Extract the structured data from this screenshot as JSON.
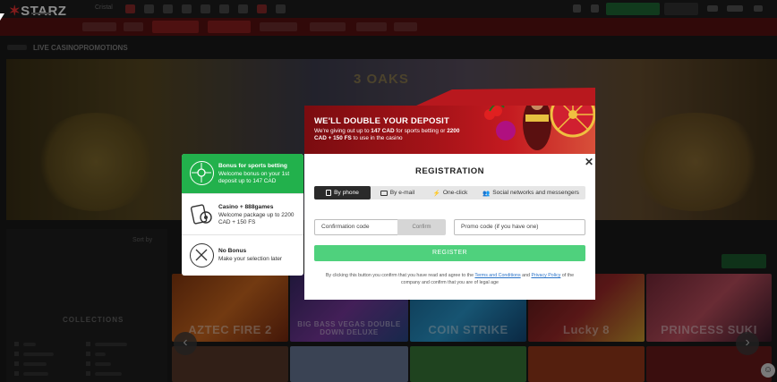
{
  "background": {
    "logo": "STARZ",
    "favorites_label": "Cristal",
    "subnav": [
      "LIVE CASINO",
      "PROMOTIONS"
    ],
    "filter_label": "Sort by",
    "collections_heading": "COLLECTIONS",
    "hero_logo": "3 OAKS",
    "games_row1": [
      "AZTEC FIRE 2",
      "BIG BASS VEGAS DOUBLE DOWN DELUXE",
      "COIN STRIKE",
      "",
      "Lucky 8",
      "PRINCESS SUKI"
    ],
    "prev_arrow": "‹",
    "next_arrow": "›",
    "chat_icon": "☺"
  },
  "bonus_panel": {
    "options": [
      {
        "title": "Bonus for sports betting",
        "desc": "Welcome bonus on your 1st deposit up to 147 CAD",
        "icon": "soccer-ball-icon",
        "active": true
      },
      {
        "title": "Casino + 888games",
        "desc": "Welcome package up to 2200 CAD + 150 FS",
        "icon": "casino-cards-icon",
        "active": false
      },
      {
        "title": "No Bonus",
        "desc": "Make your selection later",
        "icon": "no-bonus-icon",
        "active": false
      }
    ]
  },
  "promo": {
    "title": "WE'LL DOUBLE YOUR DEPOSIT",
    "text_prefix": "We're giving out up to ",
    "sports_amount": "147 CAD",
    "text_mid": " for sports betting or ",
    "casino_amount": "2200 CAD + 150 FS",
    "text_suffix": " to use in the casino"
  },
  "registration": {
    "title": "REGISTRATION",
    "close": "✕",
    "tabs": [
      {
        "label": "By phone",
        "active": true,
        "icon": "phone-icon"
      },
      {
        "label": "By e-mail",
        "active": false,
        "icon": "email-icon"
      },
      {
        "label": "One-click",
        "active": false,
        "icon": "lightning-icon"
      },
      {
        "label": "Social networks and messengers",
        "active": false,
        "icon": "people-icon"
      }
    ],
    "confirmation_placeholder": "Confirmation code",
    "confirm_label": "Confirm",
    "promo_placeholder": "Promo code (if you have one)",
    "register_label": "REGISTER",
    "terms_prefix": "By clicking this button you confirm that you have read and agree to the ",
    "terms_link": "Terms and Conditions",
    "terms_and": " and ",
    "privacy_link": "Privacy Policy",
    "terms_suffix": " of the company and confirm that you are of legal age"
  },
  "colors": {
    "accent_green": "#22b14c",
    "register_green": "#4fd17d",
    "promo_red": "#a51318",
    "link_blue": "#2a73c8"
  }
}
